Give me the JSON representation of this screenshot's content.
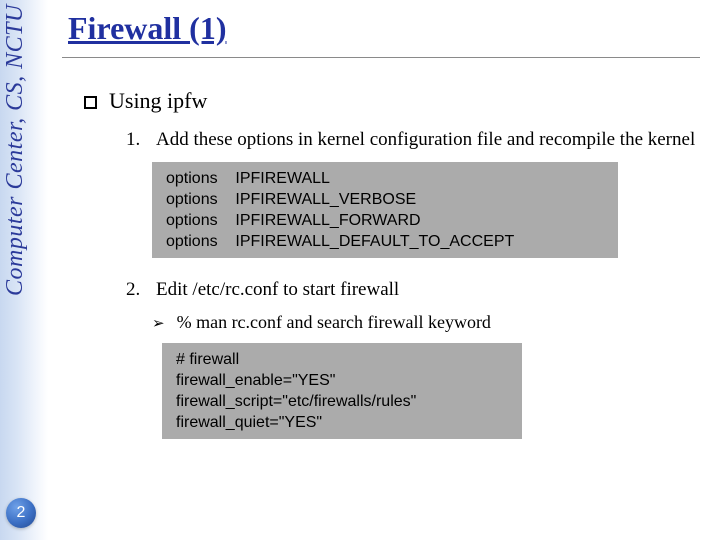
{
  "sidebar": {
    "label": "Computer Center, CS, NCTU",
    "page_number": "2"
  },
  "title": "Firewall (1)",
  "main_bullet": "Using ipfw",
  "items": [
    {
      "num": "1.",
      "text": "Add these options in kernel configuration file and recompile the kernel"
    },
    {
      "num": "2.",
      "text": "Edit /etc/rc.conf to start firewall"
    }
  ],
  "sub_bullet": "% man rc.conf and search firewall keyword",
  "code1": "options    IPFIREWALL\noptions    IPFIREWALL_VERBOSE\noptions    IPFIREWALL_FORWARD\noptions    IPFIREWALL_DEFAULT_TO_ACCEPT",
  "code2": "# firewall\nfirewall_enable=\"YES\"\nfirewall_script=\"etc/firewalls/rules\"\nfirewall_quiet=\"YES\""
}
